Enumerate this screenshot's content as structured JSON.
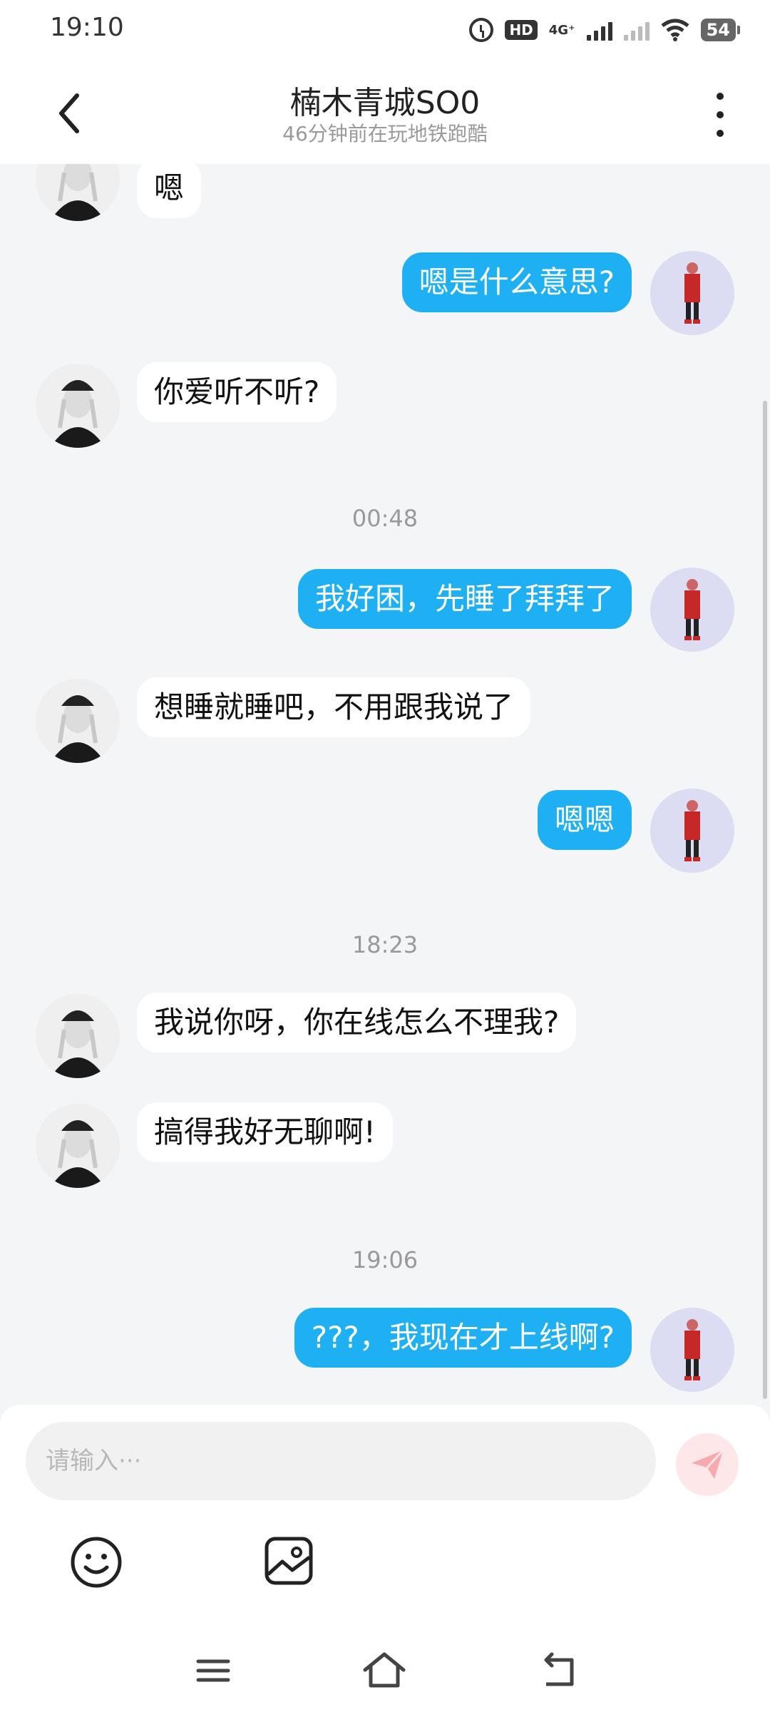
{
  "status_bar": {
    "time": "19:10",
    "network_label": "4G⁺",
    "hd_label": "HD",
    "battery_level": "54"
  },
  "header": {
    "title": "楠木青城SO0",
    "subtitle": "46分钟前在玩地铁跑酷"
  },
  "messages": [
    {
      "side": "left",
      "text": "嗯"
    },
    {
      "side": "right",
      "text": "嗯是什么意思?"
    },
    {
      "side": "left",
      "text": "你爱听不听?"
    },
    {
      "type": "time",
      "text": "00:48"
    },
    {
      "side": "right",
      "text": "我好困，先睡了拜拜了"
    },
    {
      "side": "left",
      "text": "想睡就睡吧，不用跟我说了"
    },
    {
      "side": "right",
      "text": "嗯嗯"
    },
    {
      "type": "time",
      "text": "18:23"
    },
    {
      "side": "left",
      "text": "我说你呀，你在线怎么不理我?"
    },
    {
      "side": "left",
      "text": "搞得我好无聊啊!"
    },
    {
      "type": "time",
      "text": "19:06"
    },
    {
      "side": "right",
      "text": "???，我现在才上线啊?"
    }
  ],
  "input": {
    "placeholder": "请输入···"
  },
  "icons": {
    "back": "chevron-left-icon",
    "more": "more-vertical-icon",
    "send": "paper-plane-icon",
    "emoji": "smiley-icon",
    "image": "image-icon",
    "menu": "menu-icon",
    "home": "home-icon",
    "back_nav": "back-arrow-icon"
  },
  "colors": {
    "accent": "#1fb0f3",
    "send_disabled": "#fde7e8",
    "send_icon": "#f7a9ad"
  }
}
